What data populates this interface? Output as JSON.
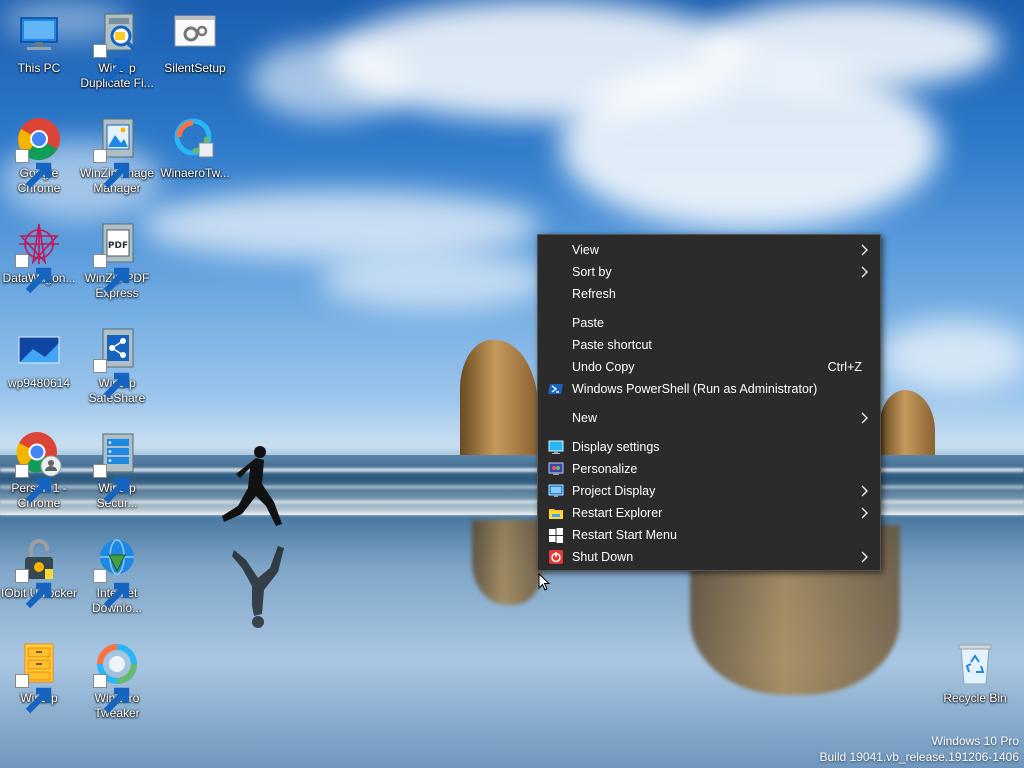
{
  "desktop_icons": [
    {
      "id": "this-pc",
      "label": "This PC"
    },
    {
      "id": "winzip-duplicate",
      "label": "WinZip Duplicate Fi..."
    },
    {
      "id": "silentsetup",
      "label": "SilentSetup"
    },
    {
      "id": "google-chrome",
      "label": "Google Chrome"
    },
    {
      "id": "winzip-image",
      "label": "WinZip Image Manager"
    },
    {
      "id": "winaero-tw",
      "label": "WinaeroTw..."
    },
    {
      "id": "datawagon",
      "label": "DataWagon..."
    },
    {
      "id": "winzip-pdf",
      "label": "WinZip PDF Express"
    },
    {
      "id": "wp",
      "label": "wp9480614"
    },
    {
      "id": "winzip-safeshare",
      "label": "WinZip SafeShare"
    },
    {
      "id": "person1-chrome",
      "label": "Person 1 - Chrome"
    },
    {
      "id": "winzip-secure",
      "label": "WinZip Secur..."
    },
    {
      "id": "iobit-unlocker",
      "label": "IObit Unlocker"
    },
    {
      "id": "internet-download",
      "label": "Internet Downlo..."
    },
    {
      "id": "winzip",
      "label": "WinZip"
    },
    {
      "id": "winaero-tweaker",
      "label": "Winaero Tweaker"
    },
    {
      "id": "recycle-bin",
      "label": "Recycle Bin"
    }
  ],
  "context_menu": {
    "items": [
      {
        "label": "View",
        "submenu": true
      },
      {
        "label": "Sort by",
        "submenu": true
      },
      {
        "label": "Refresh"
      },
      {
        "label": "Paste"
      },
      {
        "label": "Paste shortcut"
      },
      {
        "label": "Undo Copy",
        "shortcut": "Ctrl+Z"
      },
      {
        "label": "Windows PowerShell (Run as Administrator)",
        "icon": "powershell-icon"
      },
      {
        "label": "New",
        "submenu": true
      },
      {
        "label": "Display settings",
        "icon": "display-icon"
      },
      {
        "label": "Personalize",
        "icon": "personalize-icon"
      },
      {
        "label": "Project Display",
        "icon": "project-display-icon",
        "submenu": true
      },
      {
        "label": "Restart Explorer",
        "icon": "folder-icon",
        "submenu": true
      },
      {
        "label": "Restart Start Menu",
        "icon": "windows-logo-icon"
      },
      {
        "label": "Shut Down",
        "icon": "power-icon",
        "submenu": true
      }
    ]
  },
  "watermark": {
    "edition": "Windows 10 Pro",
    "build": "Build 19041.vb_release.191206-1406"
  },
  "colors": {
    "menu_bg": "#2b2b2b",
    "menu_text": "#ffffff"
  }
}
